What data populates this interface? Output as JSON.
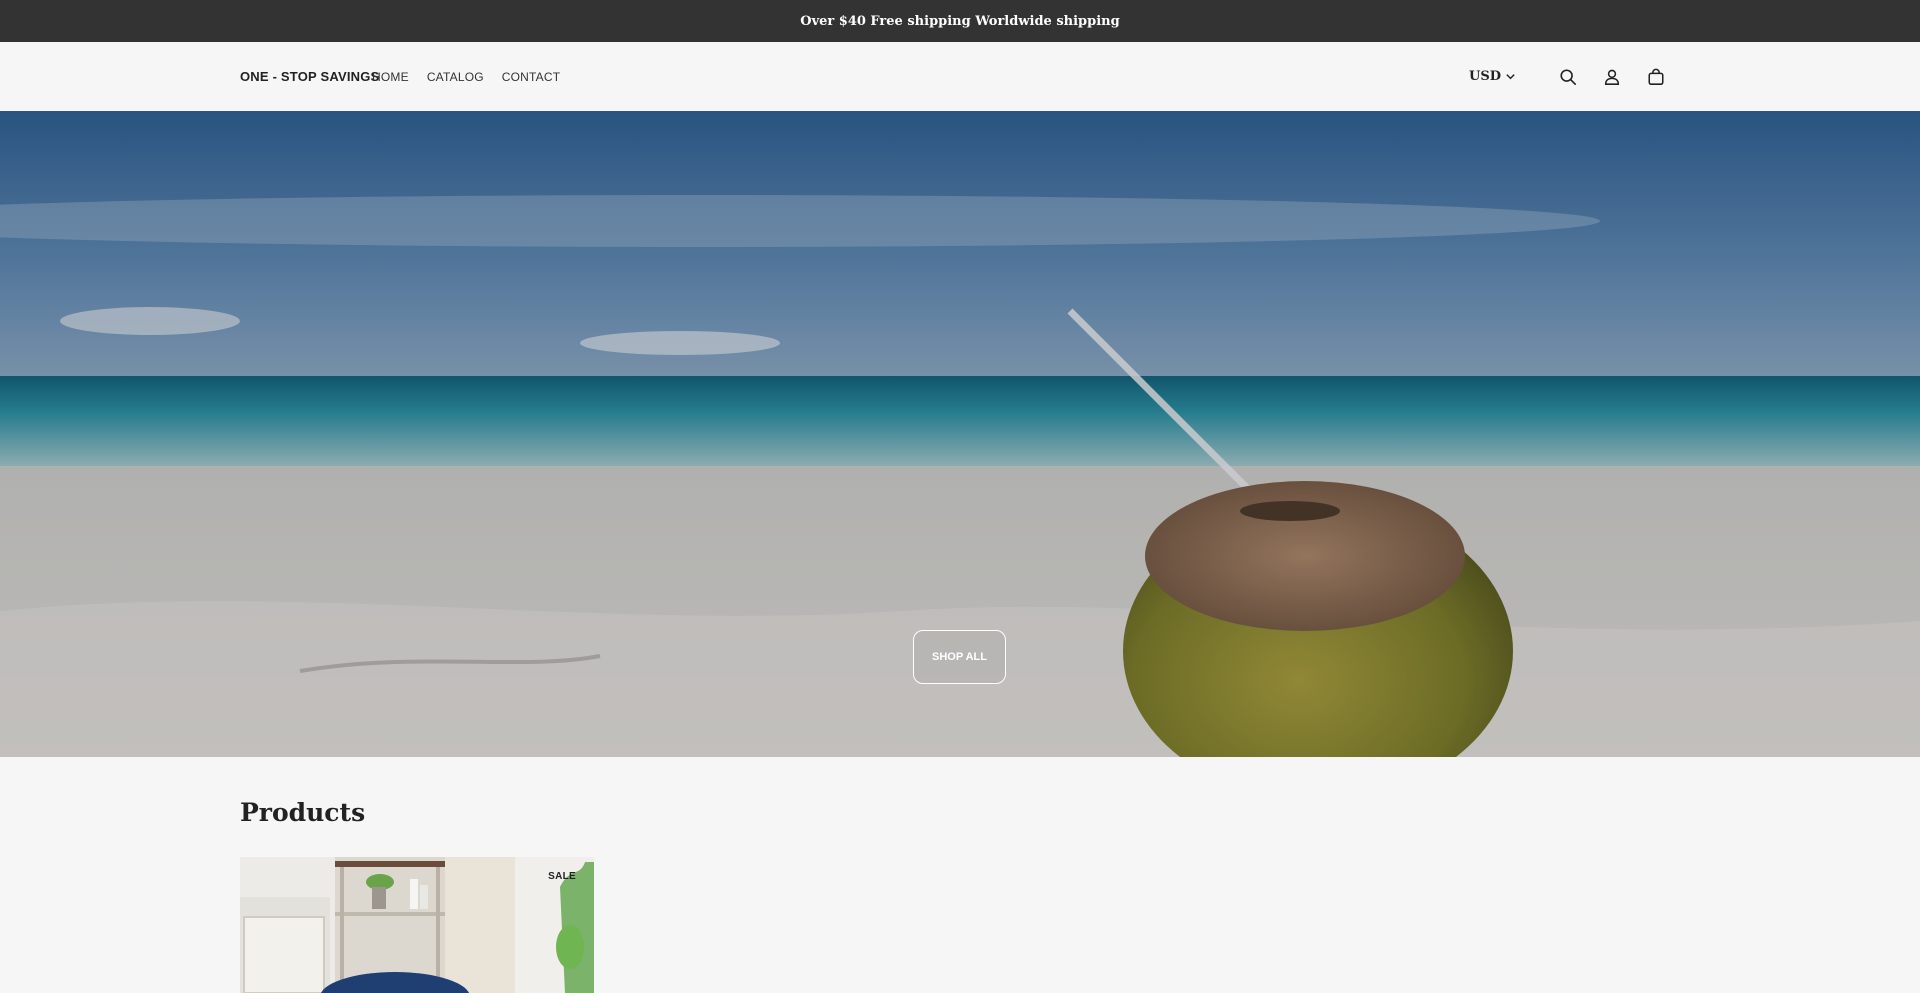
{
  "announcement": {
    "text": "Over $40 Free shipping Worldwide shipping"
  },
  "header": {
    "logo": "ONE - STOP SAVINGS",
    "nav": [
      "HOME",
      "CATALOG",
      "CONTACT"
    ],
    "currency": "USD",
    "icons": [
      "search-icon",
      "account-icon",
      "cart-icon",
      "chevron-down-icon"
    ]
  },
  "hero": {
    "button_label": "SHOP ALL"
  },
  "products": {
    "heading": "Products",
    "items": [
      {
        "badge": "SALE"
      }
    ]
  },
  "colors": {
    "announcement_bg": "#333333",
    "page_bg": "#f6f6f6",
    "text": "#222222"
  }
}
